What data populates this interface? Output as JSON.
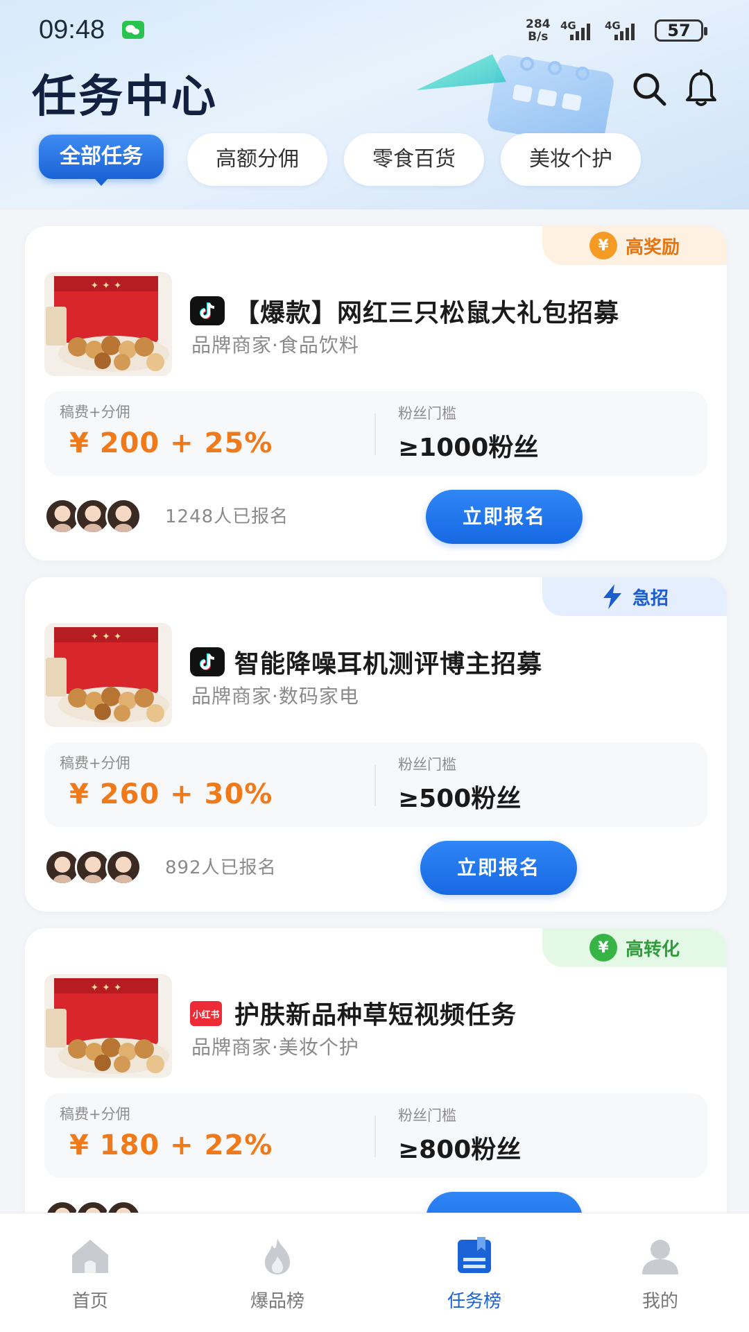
{
  "status_bar": {
    "time": "09:48",
    "net_speed_value": "284",
    "net_speed_unit": "B/s",
    "signal1": "4G",
    "signal2": "4G",
    "battery": "57"
  },
  "header": {
    "title": "任务中心",
    "search_icon": "search-icon",
    "bell_icon": "bell-icon"
  },
  "tabs": [
    {
      "label": "全部任务",
      "active": true
    },
    {
      "label": "高额分佣",
      "active": false
    },
    {
      "label": "零食百货",
      "active": false
    },
    {
      "label": "美妆个护",
      "active": false
    }
  ],
  "cards": [
    {
      "badge": {
        "label": "高奖励",
        "icon": "¥",
        "color": "orange"
      },
      "platform": "douyin",
      "title": "【爆款】网红三只松鼠大礼包招募",
      "subtitle": "品牌商家·食品饮料",
      "fee_label": "稿费+分佣",
      "fee_value": "¥ 200 + 25%",
      "fans_label": "粉丝门槛",
      "fans_value": "≥1000粉丝",
      "enroll_count": "1248人已报名",
      "button": "立即报名"
    },
    {
      "badge": {
        "label": "急招",
        "icon": "lightning",
        "color": "blue"
      },
      "platform": "douyin",
      "title": "智能降噪耳机测评博主招募",
      "subtitle": "品牌商家·数码家电",
      "fee_label": "稿费+分佣",
      "fee_value": "¥ 260 + 30%",
      "fans_label": "粉丝门槛",
      "fans_value": "≥500粉丝",
      "enroll_count": "892人已报名",
      "button": "立即报名"
    },
    {
      "badge": {
        "label": "高转化",
        "icon": "¥",
        "color": "green"
      },
      "platform": "xiaohongshu",
      "platform_text": "小红书",
      "title": "护肤新品种草短视频任务",
      "subtitle": "品牌商家·美妆个护",
      "fee_label": "稿费+分佣",
      "fee_value": "¥ 180 + 22%",
      "fans_label": "粉丝门槛",
      "fans_value": "≥800粉丝"
    }
  ],
  "nav": [
    {
      "label": "首页",
      "icon": "home-icon",
      "active": false
    },
    {
      "label": "爆品榜",
      "icon": "flame-icon",
      "active": false
    },
    {
      "label": "任务榜",
      "icon": "task-board-icon",
      "active": true
    },
    {
      "label": "我的",
      "icon": "profile-icon",
      "active": false
    }
  ],
  "colors": {
    "primary": "#1769e3",
    "accent_orange": "#f07a1a",
    "background": "#f3f5f8"
  }
}
